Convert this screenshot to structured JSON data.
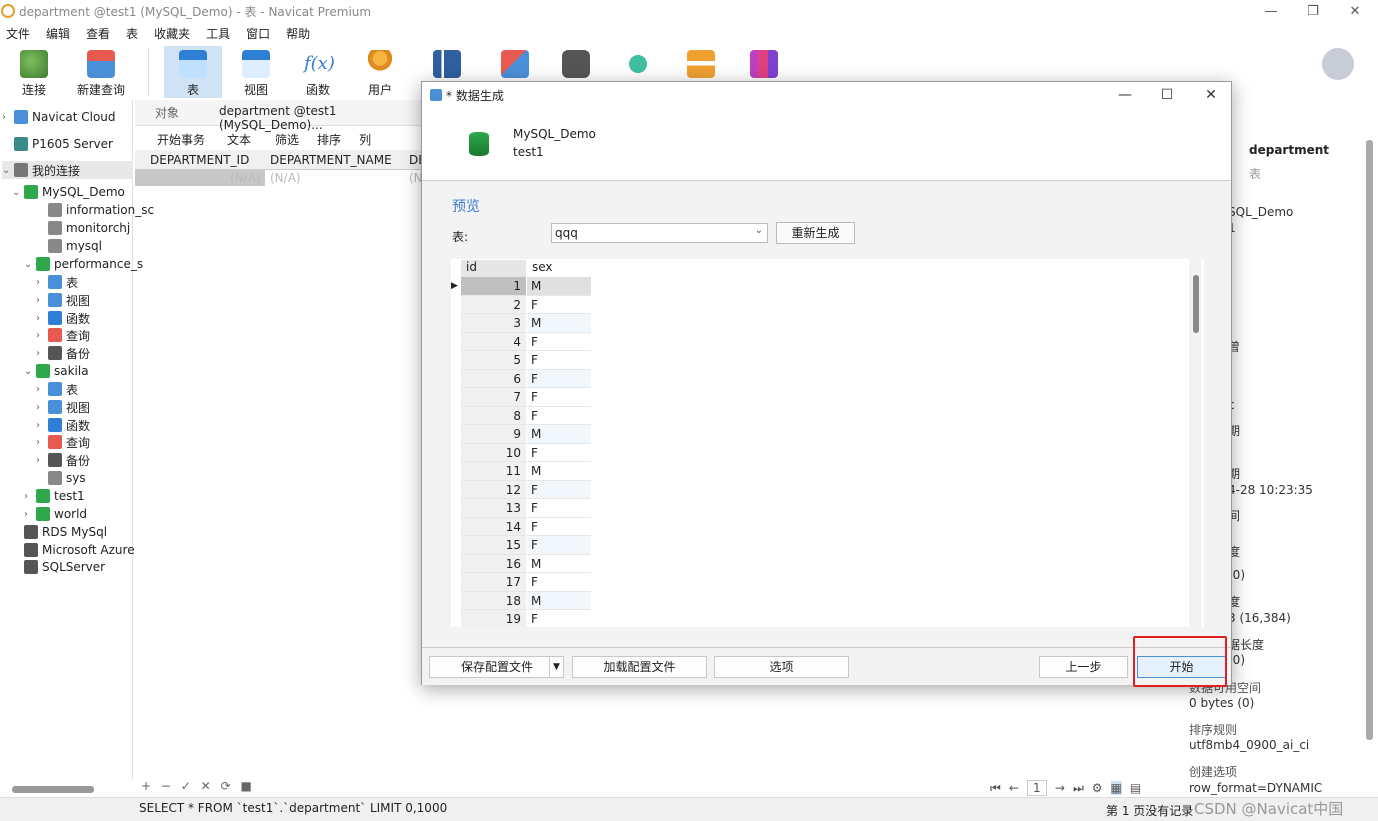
{
  "window": {
    "title": "department @test1 (MySQL_Demo) - 表 - Navicat Premium",
    "controls": [
      "—",
      "❐",
      "✕"
    ]
  },
  "menu": [
    "文件",
    "编辑",
    "查看",
    "表",
    "收藏夹",
    "工具",
    "窗口",
    "帮助"
  ],
  "toolbar": {
    "items": [
      {
        "label": "连接",
        "icon": "plug-icon"
      },
      {
        "label": "新建查询",
        "icon": "new-query-icon"
      },
      {
        "label": "表",
        "icon": "table-icon"
      },
      {
        "label": "视图",
        "icon": "view-icon"
      },
      {
        "label": "函数",
        "icon": "function-icon"
      },
      {
        "label": "用户",
        "icon": "user-icon"
      }
    ]
  },
  "nav": {
    "items": [
      {
        "label": "Navicat Cloud",
        "icon": "cloud-icon"
      },
      {
        "label": "P1605 Server",
        "icon": "server-icon"
      },
      {
        "label": "我的连接",
        "icon": "connection-icon"
      },
      {
        "label": "MySQL_Demo",
        "icon": "mysql-icon"
      },
      {
        "label": "information_sc",
        "icon": "database-icon"
      },
      {
        "label": "monitorchj",
        "icon": "database-icon"
      },
      {
        "label": "mysql",
        "icon": "database-icon"
      },
      {
        "label": "performance_s",
        "icon": "database-icon"
      },
      {
        "label": "表",
        "icon": "table-icon"
      },
      {
        "label": "视图",
        "icon": "view-icon"
      },
      {
        "label": "函数",
        "icon": "function-icon"
      },
      {
        "label": "查询",
        "icon": "query-icon"
      },
      {
        "label": "备份",
        "icon": "backup-icon"
      },
      {
        "label": "sakila",
        "icon": "database-icon"
      },
      {
        "label": "表",
        "icon": "table-icon"
      },
      {
        "label": "视图",
        "icon": "view-icon"
      },
      {
        "label": "函数",
        "icon": "function-icon"
      },
      {
        "label": "查询",
        "icon": "query-icon"
      },
      {
        "label": "备份",
        "icon": "backup-icon"
      },
      {
        "label": "sys",
        "icon": "database-icon"
      },
      {
        "label": "test1",
        "icon": "database-icon"
      },
      {
        "label": "world",
        "icon": "database-icon"
      },
      {
        "label": "RDS MySql",
        "icon": "rds-icon"
      },
      {
        "label": "Microsoft Azure",
        "icon": "azure-icon"
      },
      {
        "label": "SQLServer",
        "icon": "sqlserver-icon"
      }
    ]
  },
  "tabs": {
    "objects": "对象",
    "active": "department @test1 (MySQL_Demo)..."
  },
  "subtoolbar": {
    "begin_tx": "开始事务",
    "text": "文本",
    "filter": "筛选",
    "sort": "排序",
    "columns": "列"
  },
  "grid": {
    "headers": [
      "DEPARTMENT_ID",
      "DEPARTMENT_NAME",
      "DE"
    ],
    "row": [
      "(N/A)",
      "(N/A)",
      "(N"
    ]
  },
  "status": {
    "sql": "SELECT * FROM `test1`.`department` LIMIT 0,1000",
    "page_info": "第 1 页没有记录",
    "watermark": "CSDN @Navicat中国",
    "page_number": "1"
  },
  "info": {
    "name": "department",
    "type": "表",
    "lines": [
      "SQL_Demo",
      "1",
      "曾",
      "c",
      "期",
      "期",
      "4-28 10:23:35",
      "间",
      "度",
      "(0)",
      "度",
      "3 (16,384)",
      "据长度",
      "(0)",
      "数据可用空间",
      "0 bytes (0)",
      "排序规则",
      "utf8mb4_0900_ai_ci",
      "创建选项",
      "row_format=DYNAMIC"
    ]
  },
  "dialog": {
    "title": "* 数据生成",
    "connection": "MySQL_Demo",
    "database": "test1",
    "preview_title": "预览",
    "table_label": "表:",
    "table_value": "qqq",
    "regenerate": "重新生成",
    "columns": [
      "id",
      "sex"
    ],
    "rows": [
      [
        "1",
        "M"
      ],
      [
        "2",
        "F"
      ],
      [
        "3",
        "M"
      ],
      [
        "4",
        "F"
      ],
      [
        "5",
        "F"
      ],
      [
        "6",
        "F"
      ],
      [
        "7",
        "F"
      ],
      [
        "8",
        "F"
      ],
      [
        "9",
        "M"
      ],
      [
        "10",
        "F"
      ],
      [
        "11",
        "M"
      ],
      [
        "12",
        "F"
      ],
      [
        "13",
        "F"
      ],
      [
        "14",
        "F"
      ],
      [
        "15",
        "F"
      ],
      [
        "16",
        "M"
      ],
      [
        "17",
        "F"
      ],
      [
        "18",
        "M"
      ],
      [
        "19",
        "F"
      ]
    ],
    "buttons": {
      "save_config": "保存配置文件",
      "load_config": "加载配置文件",
      "options": "选项",
      "back": "上一步",
      "start": "开始"
    }
  },
  "colors": {
    "accent": "#3a7bd5",
    "highlight": "#e02020",
    "selected_tab": "#cfe3f5"
  }
}
